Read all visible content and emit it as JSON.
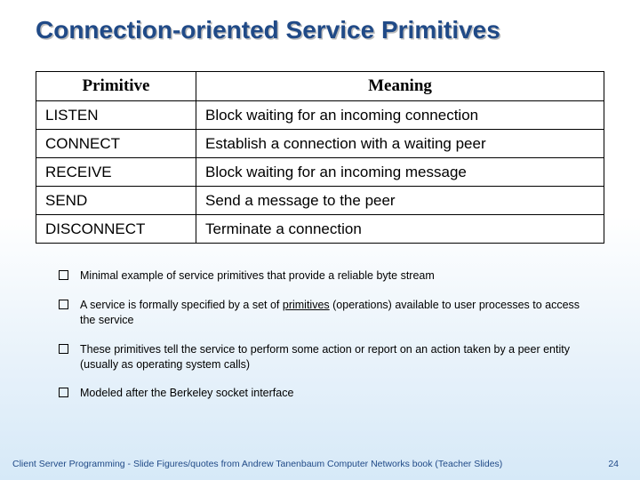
{
  "title": "Connection-oriented Service Primitives",
  "table": {
    "headers": [
      "Primitive",
      "Meaning"
    ],
    "rows": [
      {
        "primitive": "LISTEN",
        "meaning": "Block waiting for an incoming connection"
      },
      {
        "primitive": "CONNECT",
        "meaning": "Establish a connection with a waiting peer"
      },
      {
        "primitive": "RECEIVE",
        "meaning": "Block waiting for an incoming message"
      },
      {
        "primitive": "SEND",
        "meaning": "Send a message to the peer"
      },
      {
        "primitive": "DISCONNECT",
        "meaning": "Terminate a connection"
      }
    ]
  },
  "bullets": [
    "Minimal example of service primitives that provide a reliable byte stream",
    "A service is formally specified by a set of primitives (operations) available to user processes to access the service",
    "These primitives tell the service to perform some action or report on an action taken by a peer entity (usually as operating system calls)",
    "Modeled after the Berkeley socket interface"
  ],
  "bullet_underline_word": "primitives",
  "footer": {
    "left": "Client Server Programming    - Slide Figures/quotes from Andrew Tanenbaum Computer Networks book (Teacher Slides)",
    "page": "24"
  }
}
